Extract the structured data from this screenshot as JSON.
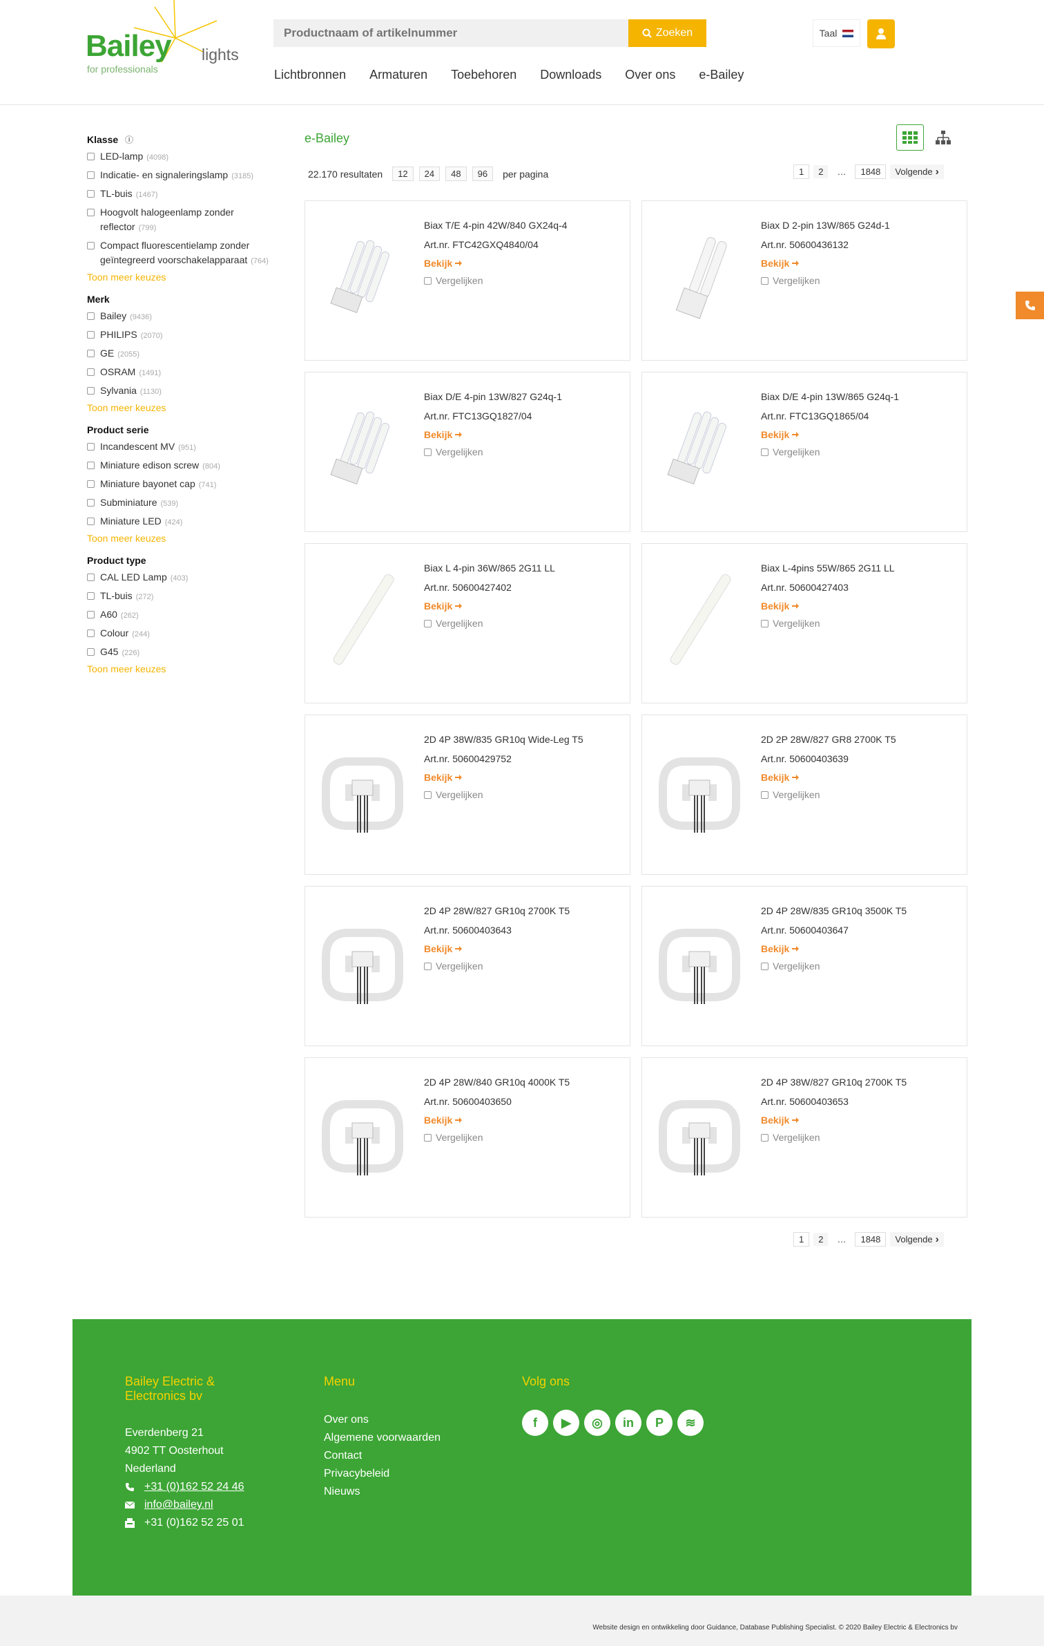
{
  "brand": {
    "name": "Bailey",
    "sub": "lights",
    "tag": "for professionals"
  },
  "header": {
    "search_placeholder": "Productnaam of artikelnummer",
    "search_button": "Zoeken",
    "lang_label": "Taal"
  },
  "nav": [
    "Lichtbronnen",
    "Armaturen",
    "Toebehoren",
    "Downloads",
    "Over ons",
    "e-Bailey"
  ],
  "filters": [
    {
      "title": "Klasse",
      "info": true,
      "options": [
        {
          "label": "LED-lamp",
          "count": "(4098)"
        },
        {
          "label": "Indicatie- en signaleringslamp",
          "count": "(3185)"
        },
        {
          "label": "TL-buis",
          "count": "(1467)"
        },
        {
          "label": "Hoogvolt halogeenlamp zonder reflector",
          "count": "(799)"
        },
        {
          "label": "Compact fluorescentielamp zonder geïntegreerd voorschakelapparaat",
          "count": "(764)"
        }
      ],
      "more": "Toon meer keuzes"
    },
    {
      "title": "Merk",
      "options": [
        {
          "label": "Bailey",
          "count": "(9436)"
        },
        {
          "label": "PHILIPS",
          "count": "(2070)"
        },
        {
          "label": "GE",
          "count": "(2055)"
        },
        {
          "label": "OSRAM",
          "count": "(1491)"
        },
        {
          "label": "Sylvania",
          "count": "(1130)"
        }
      ],
      "more": "Toon meer keuzes"
    },
    {
      "title": "Product serie",
      "options": [
        {
          "label": "Incandescent MV",
          "count": "(951)"
        },
        {
          "label": "Miniature edison screw",
          "count": "(804)"
        },
        {
          "label": "Miniature bayonet cap",
          "count": "(741)"
        },
        {
          "label": "Subminiature",
          "count": "(539)"
        },
        {
          "label": "Miniature LED",
          "count": "(424)"
        }
      ],
      "more": "Toon meer keuzes"
    },
    {
      "title": "Product type",
      "options": [
        {
          "label": "CAL LED Lamp",
          "count": "(403)"
        },
        {
          "label": "TL-buis",
          "count": "(272)"
        },
        {
          "label": "A60",
          "count": "(262)"
        },
        {
          "label": "Colour",
          "count": "(244)"
        },
        {
          "label": "G45",
          "count": "(226)"
        }
      ],
      "more": "Toon meer keuzes"
    }
  ],
  "main": {
    "title": "e-Bailey",
    "results": "22.170 resultaten",
    "per_page": [
      "12",
      "24",
      "48",
      "96"
    ],
    "per_page_label": "per pagina",
    "pages": [
      "1",
      "2",
      "…",
      "1848"
    ],
    "next": "Volgende"
  },
  "products": [
    {
      "title": "Biax T/E 4-pin 42W/840 GX24q-4",
      "art": "Art.nr. FTC42GXQ4840/04",
      "img": "quad"
    },
    {
      "title": "Biax D 2-pin 13W/865 G24d-1",
      "art": "Art.nr. 50600436132",
      "img": "double"
    },
    {
      "title": "Biax D/E 4-pin 13W/827 G24q-1",
      "art": "Art.nr. FTC13GQ1827/04",
      "img": "quad"
    },
    {
      "title": "Biax D/E 4-pin 13W/865 G24q-1",
      "art": "Art.nr. FTC13GQ1865/04",
      "img": "quad"
    },
    {
      "title": "Biax L 4-pin 36W/865 2G11 LL",
      "art": "Art.nr. 50600427402",
      "img": "long"
    },
    {
      "title": "Biax L-4pins 55W/865 2G11 LL",
      "art": "Art.nr. 50600427403",
      "img": "long"
    },
    {
      "title": "2D 4P 38W/835 GR10q Wide-Leg T5",
      "art": "Art.nr. 50600429752",
      "img": "2d"
    },
    {
      "title": "2D 2P 28W/827 GR8 2700K T5",
      "art": "Art.nr. 50600403639",
      "img": "2d"
    },
    {
      "title": "2D 4P 28W/827 GR10q 2700K T5",
      "art": "Art.nr. 50600403643",
      "img": "2d"
    },
    {
      "title": "2D 4P 28W/835 GR10q 3500K T5",
      "art": "Art.nr. 50600403647",
      "img": "2d"
    },
    {
      "title": "2D 4P 28W/840 GR10q 4000K T5",
      "art": "Art.nr. 50600403650",
      "img": "2d"
    },
    {
      "title": "2D 4P 38W/827 GR10q 2700K T5",
      "art": "Art.nr. 50600403653",
      "img": "2d"
    }
  ],
  "product_labels": {
    "view": "Bekijk",
    "compare": "Vergelijken"
  },
  "footer": {
    "company": [
      "Bailey Electric &",
      "Electronics bv"
    ],
    "address": [
      "Everdenberg 21",
      "4902 TT Oosterhout",
      "Nederland"
    ],
    "phone": "+31 (0)162 52 24 46",
    "email": "info@bailey.nl",
    "fax": "+31 (0)162 52 25 01",
    "menu_title": "Menu",
    "menu": [
      "Over ons",
      "Algemene voorwaarden",
      "Contact",
      "Privacybeleid",
      "Nieuws"
    ],
    "social_title": "Volg ons",
    "social": [
      "facebook-icon",
      "youtube-icon",
      "instagram-icon",
      "linkedin-icon",
      "pinterest-icon",
      "rss-icon"
    ],
    "credit": "Website design en ontwikkeling door Guidance, Database Publishing Specialist. © 2020 Bailey Electric & Electronics bv"
  },
  "colors": {
    "green": "#3ca535",
    "yellow": "#f5b400",
    "orange": "#f08a2b"
  }
}
